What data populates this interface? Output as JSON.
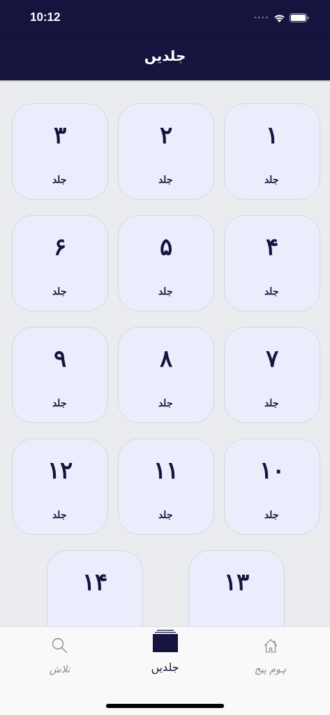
{
  "status_bar": {
    "time": "10:12"
  },
  "header": {
    "title": "جلدیں"
  },
  "volumes": [
    {
      "number": "۱",
      "label": "جلد"
    },
    {
      "number": "۲",
      "label": "جلد"
    },
    {
      "number": "۳",
      "label": "جلد"
    },
    {
      "number": "۴",
      "label": "جلد"
    },
    {
      "number": "۵",
      "label": "جلد"
    },
    {
      "number": "۶",
      "label": "جلد"
    },
    {
      "number": "۷",
      "label": "جلد"
    },
    {
      "number": "۸",
      "label": "جلد"
    },
    {
      "number": "۹",
      "label": "جلد"
    },
    {
      "number": "۱۰",
      "label": "جلد"
    },
    {
      "number": "۱۱",
      "label": "جلد"
    },
    {
      "number": "۱۲",
      "label": "جلد"
    },
    {
      "number": "۱۳"
    },
    {
      "number": "۱۴"
    }
  ],
  "tab_bar": [
    {
      "kind": "home",
      "label": "ہوم پیج",
      "selected": false
    },
    {
      "kind": "volumes",
      "label": "جلدیں",
      "selected": true
    },
    {
      "kind": "search",
      "label": "تلاش",
      "selected": false
    }
  ]
}
